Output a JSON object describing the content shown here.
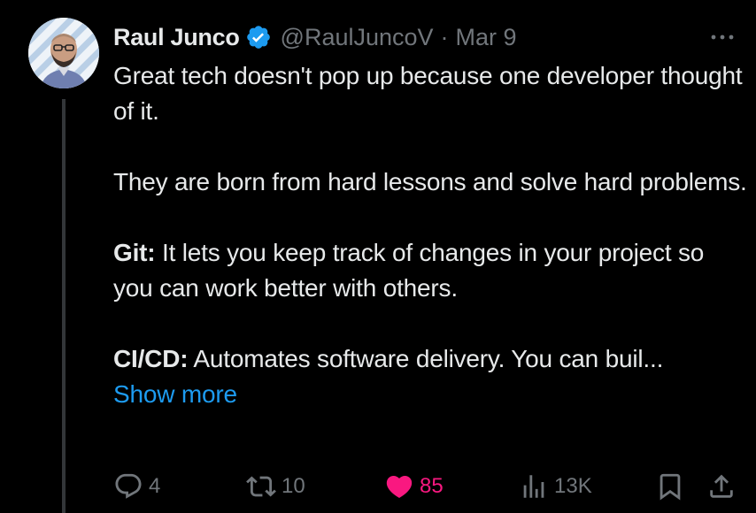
{
  "author": {
    "display_name": "Raul Junco",
    "handle": "@RaulJuncoV",
    "separator": "·",
    "date": "Mar 9",
    "verified": true
  },
  "tweet": {
    "lines": [
      "Great tech doesn't pop up because one developer thought of it.",
      "They are born from hard lessons and solve hard problems."
    ],
    "git_label": "Git:",
    "git_text": " It lets you keep track of changes in your project so you can work better with others.",
    "cicd_label": "CI/CD:",
    "cicd_text": " Automates software delivery. You can buil...",
    "show_more": "Show more"
  },
  "actions": {
    "replies": "4",
    "retweets": "10",
    "likes": "85",
    "views": "13K"
  },
  "colors": {
    "background": "#000000",
    "text": "#e7e9ea",
    "muted": "#71767b",
    "link": "#1d9bf0",
    "like": "#f91880",
    "verified": "#1d9bf0"
  },
  "icons": {
    "more": "more-icon",
    "verified": "verified-badge-icon",
    "reply": "reply-icon",
    "retweet": "retweet-icon",
    "like": "heart-icon",
    "views": "views-icon",
    "bookmark": "bookmark-icon",
    "share": "share-icon"
  }
}
